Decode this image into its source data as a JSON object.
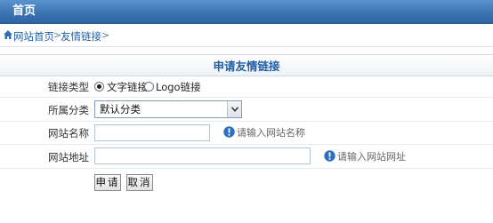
{
  "header": {
    "title": "首页"
  },
  "breadcrumb": {
    "items": [
      "网站首页",
      "友情链接"
    ],
    "separator": ">"
  },
  "form": {
    "title": "申请友情链接",
    "link_type": {
      "label": "链接类型",
      "options": [
        "文字链接",
        "Logo链接"
      ],
      "selected": "文字链接"
    },
    "category": {
      "label": "所属分类",
      "selected": "默认分类"
    },
    "site_name": {
      "label": "网站名称",
      "value": "",
      "hint": "请输入网站名称"
    },
    "site_url": {
      "label": "网站地址",
      "value": "",
      "hint": "请输入网站网址"
    },
    "buttons": {
      "submit": "申请",
      "cancel": "取消"
    }
  },
  "colors": {
    "header_bg": "#3c74b3",
    "link": "#1f5fa8",
    "info": "#2d6fc0"
  }
}
